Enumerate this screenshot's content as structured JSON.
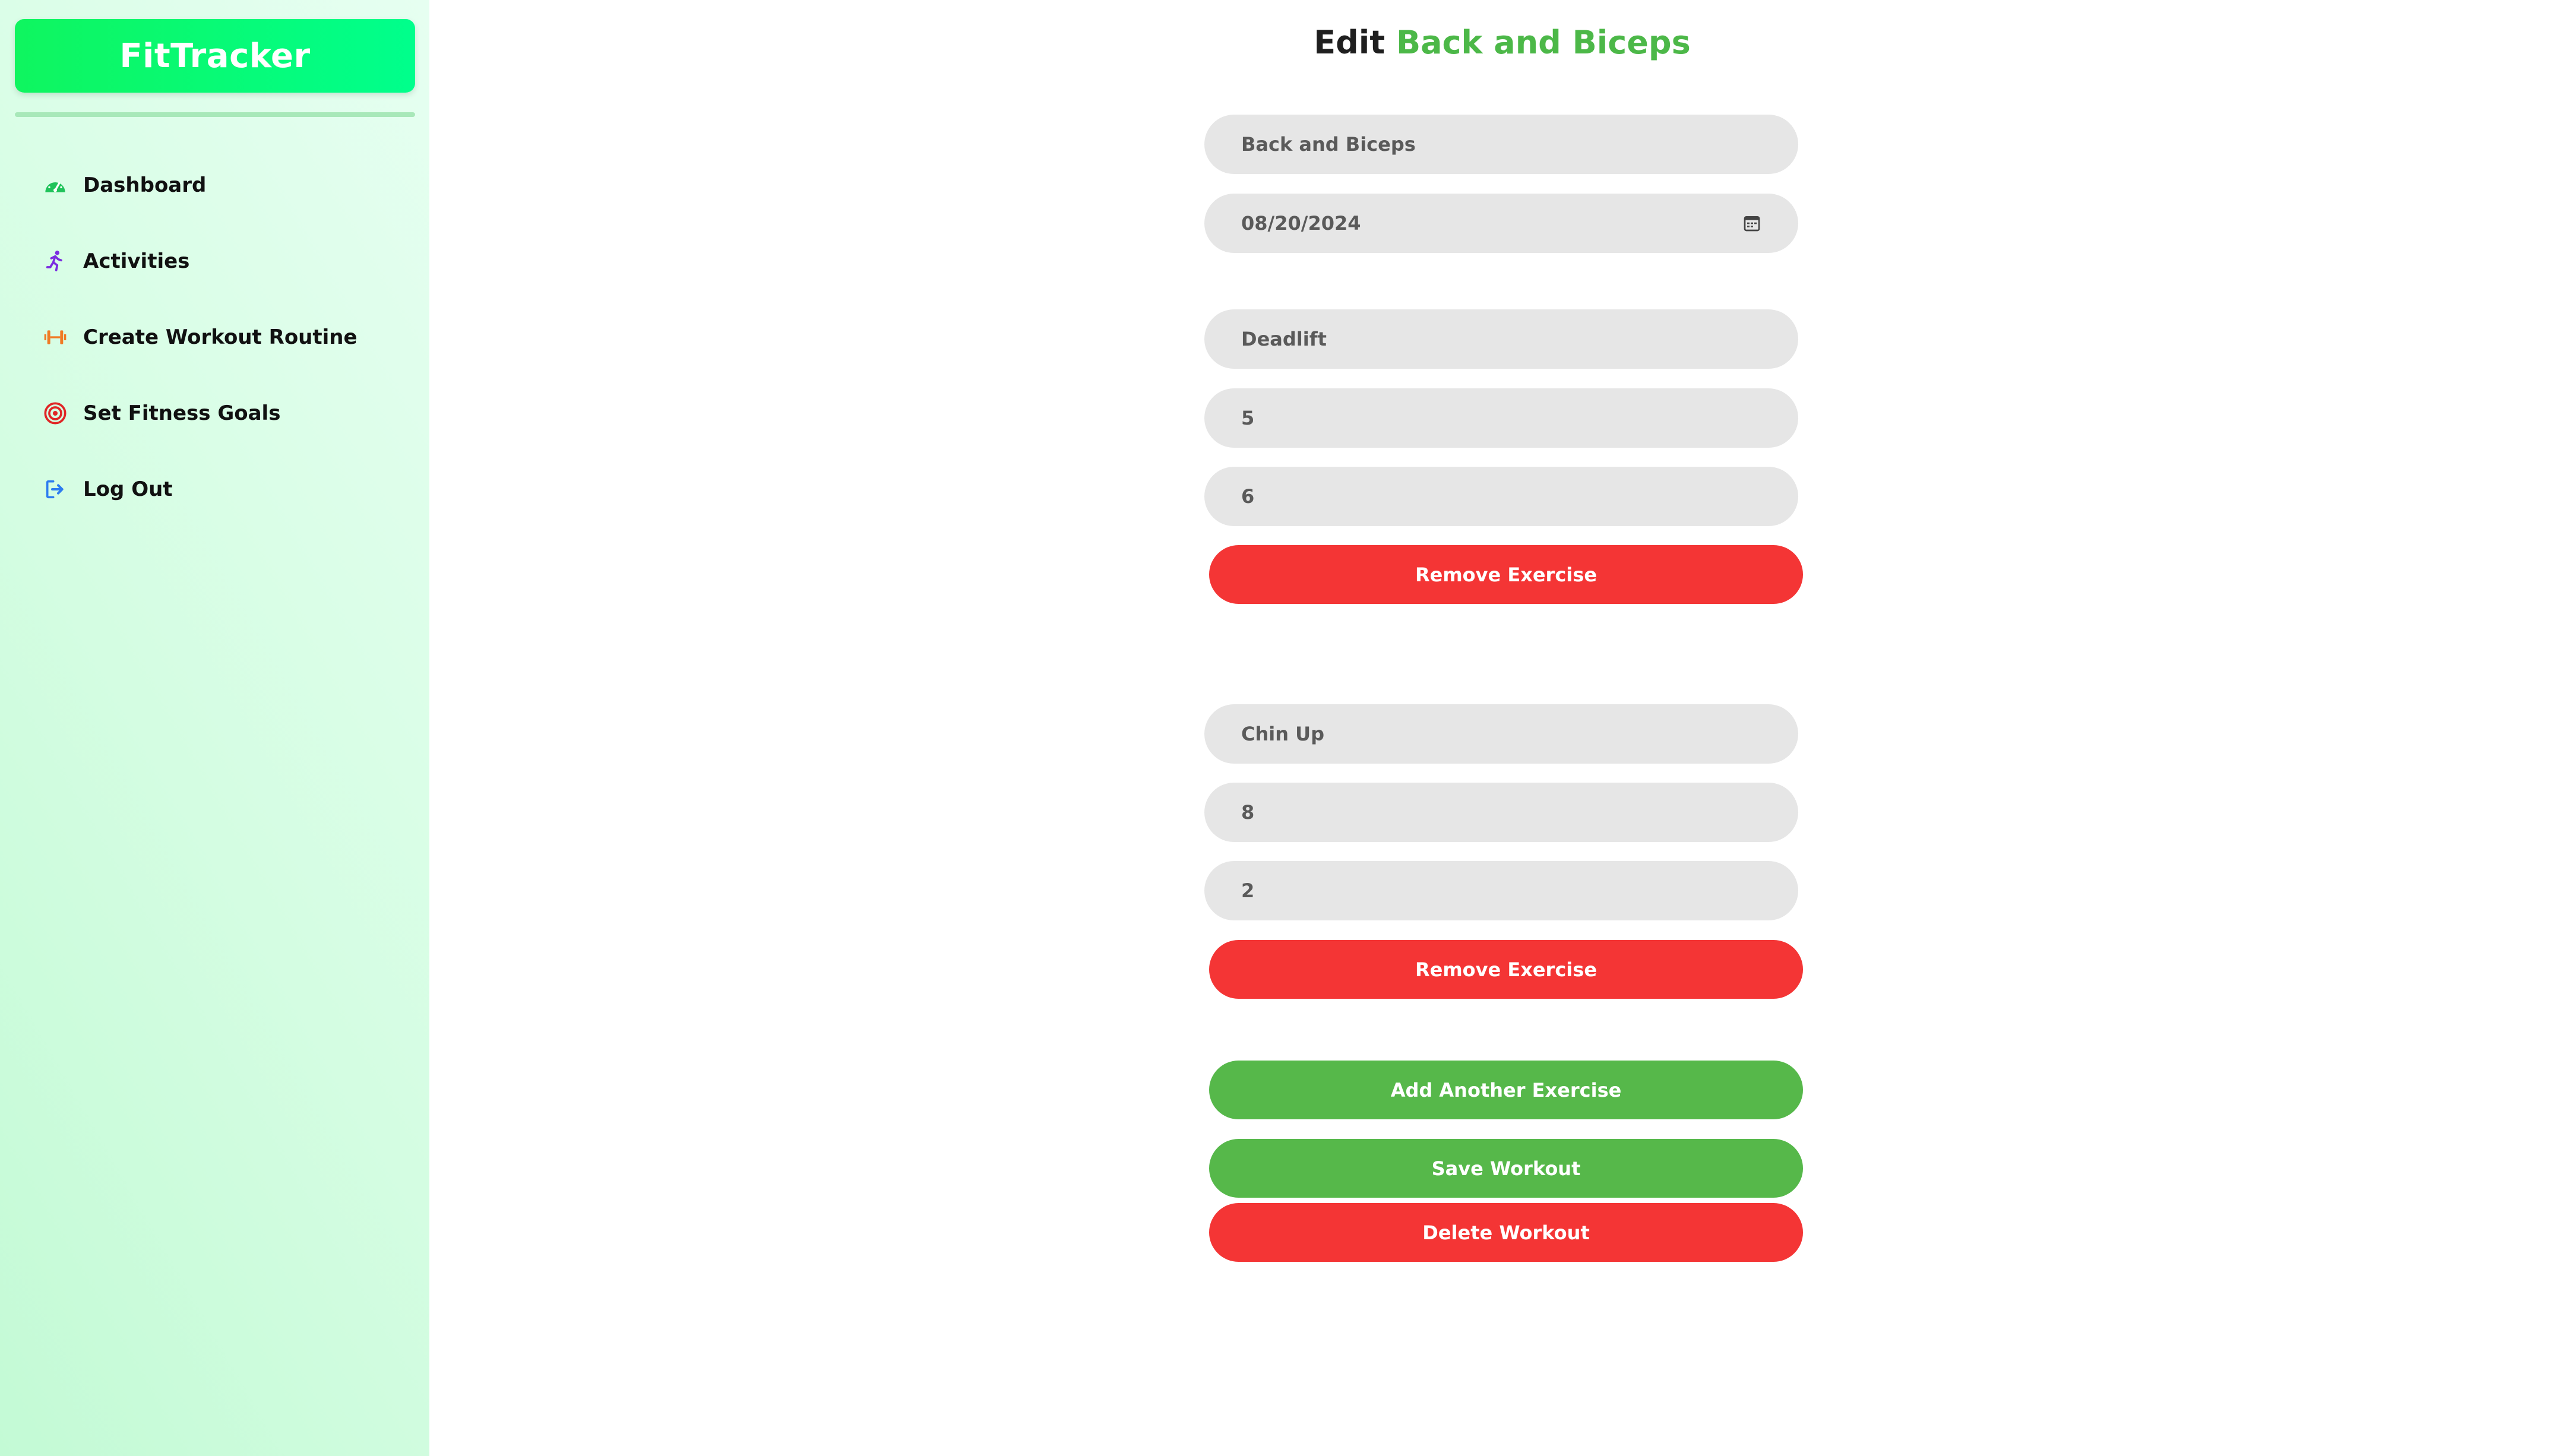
{
  "sidebar": {
    "brand": "FitTracker",
    "items": [
      {
        "label": "Dashboard",
        "icon": "speedometer-icon",
        "color": "#1fc35a"
      },
      {
        "label": "Activities",
        "icon": "running-icon",
        "color": "#7a2ce0"
      },
      {
        "label": "Create Workout Routine",
        "icon": "dumbbell-icon",
        "color": "#f07a24"
      },
      {
        "label": "Set Fitness Goals",
        "icon": "target-icon",
        "color": "#e02525"
      },
      {
        "label": "Log Out",
        "icon": "logout-icon",
        "color": "#2d7cf0"
      }
    ]
  },
  "page": {
    "title_prefix": "Edit",
    "title_workout": "Back and Biceps"
  },
  "form": {
    "workout_name": "Back and Biceps",
    "date": "08/20/2024",
    "exercises": [
      {
        "name": "Deadlift",
        "sets": "5",
        "reps": "6",
        "remove_label": "Remove Exercise"
      },
      {
        "name": "Chin Up",
        "sets": "8",
        "reps": "2",
        "remove_label": "Remove Exercise"
      }
    ],
    "add_label": "Add Another Exercise",
    "save_label": "Save Workout",
    "delete_label": "Delete Workout"
  },
  "colors": {
    "accent_green": "#4cb848",
    "danger_red": "#f43535",
    "brand_green": "#00ff8c",
    "field_gray": "#e6e6e6"
  }
}
